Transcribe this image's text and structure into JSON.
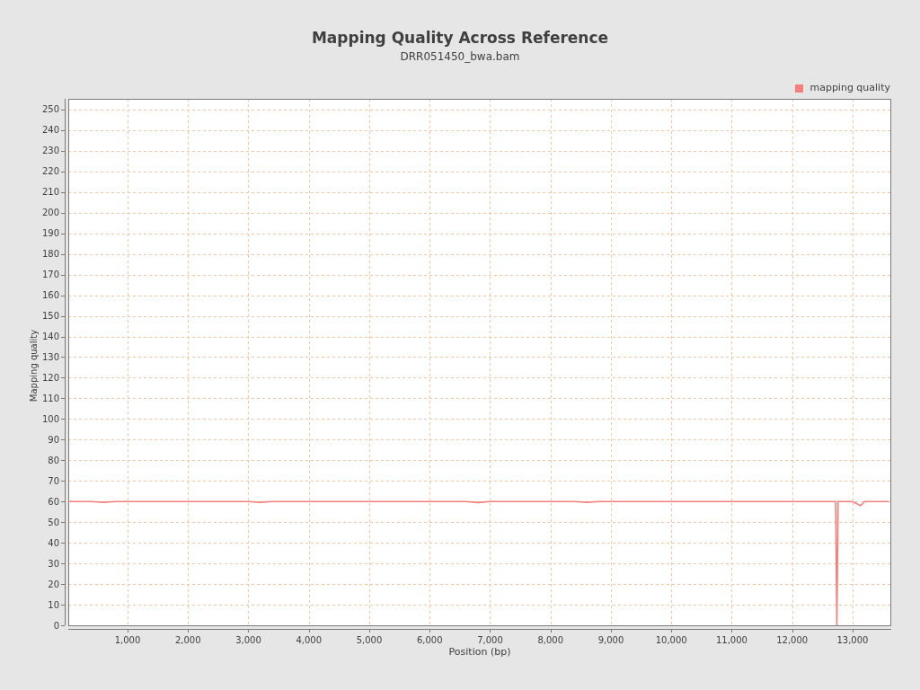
{
  "chart_data": {
    "type": "line",
    "title": "Mapping Quality Across Reference",
    "xlabel": "Position (bp)",
    "ylabel": "Mapping quality",
    "x": [
      20,
      200,
      400,
      600,
      800,
      1000,
      1200,
      1400,
      1600,
      1800,
      2000,
      2200,
      2400,
      2600,
      2800,
      3000,
      3200,
      3400,
      3600,
      3800,
      4000,
      4200,
      4400,
      4600,
      4800,
      5000,
      5200,
      5400,
      5600,
      5800,
      6000,
      6200,
      6400,
      6600,
      6800,
      7000,
      7200,
      7400,
      7600,
      7800,
      8000,
      8200,
      8400,
      8600,
      8800,
      9000,
      9200,
      9400,
      9600,
      9800,
      10000,
      10200,
      10400,
      10600,
      10800,
      11000,
      11200,
      11400,
      11600,
      11800,
      12000,
      12200,
      12400,
      12600,
      12720,
      12740,
      12760,
      12800,
      13000,
      13130,
      13200,
      13400,
      13600
    ],
    "series": [
      {
        "name": "mapping quality",
        "color": "#f47f7b",
        "values": [
          60,
          60,
          60,
          59.6,
          60,
          60,
          60,
          60,
          60,
          60,
          60,
          60,
          60,
          60,
          60,
          60,
          59.6,
          60,
          60,
          60,
          60,
          60,
          60,
          60,
          60,
          60,
          60,
          60,
          60,
          60,
          60,
          60,
          60,
          60,
          59.5,
          60,
          60,
          60,
          60,
          60,
          60,
          60,
          60,
          59.6,
          60,
          60,
          60,
          60,
          60,
          60,
          60,
          60,
          60,
          60,
          60,
          60,
          60,
          60,
          60,
          60,
          60,
          60,
          60,
          60,
          60,
          0,
          60,
          60,
          60,
          58,
          60,
          60,
          60
        ]
      }
    ],
    "grid": true,
    "xlim": [
      19,
      13640
    ],
    "ylim": [
      0,
      255.2
    ],
    "xticks": [
      {
        "value": 1000,
        "label": "1,000"
      },
      {
        "value": 2000,
        "label": "2,000"
      },
      {
        "value": 3000,
        "label": "3,000"
      },
      {
        "value": 4000,
        "label": "4,000"
      },
      {
        "value": 5000,
        "label": "5,000"
      },
      {
        "value": 6000,
        "label": "6,000"
      },
      {
        "value": 7000,
        "label": "7,000"
      },
      {
        "value": 8000,
        "label": "8,000"
      },
      {
        "value": 9000,
        "label": "9,000"
      },
      {
        "value": 10000,
        "label": "10,000"
      },
      {
        "value": 11000,
        "label": "11,000"
      },
      {
        "value": 12000,
        "label": "12,000"
      },
      {
        "value": 13000,
        "label": "13,000"
      }
    ],
    "yticks": [
      0,
      10,
      20,
      30,
      40,
      50,
      60,
      70,
      80,
      90,
      100,
      110,
      120,
      130,
      140,
      150,
      160,
      170,
      180,
      190,
      200,
      210,
      220,
      230,
      240,
      250
    ]
  },
  "subtitle": "DRR051450_bwa.bam"
}
